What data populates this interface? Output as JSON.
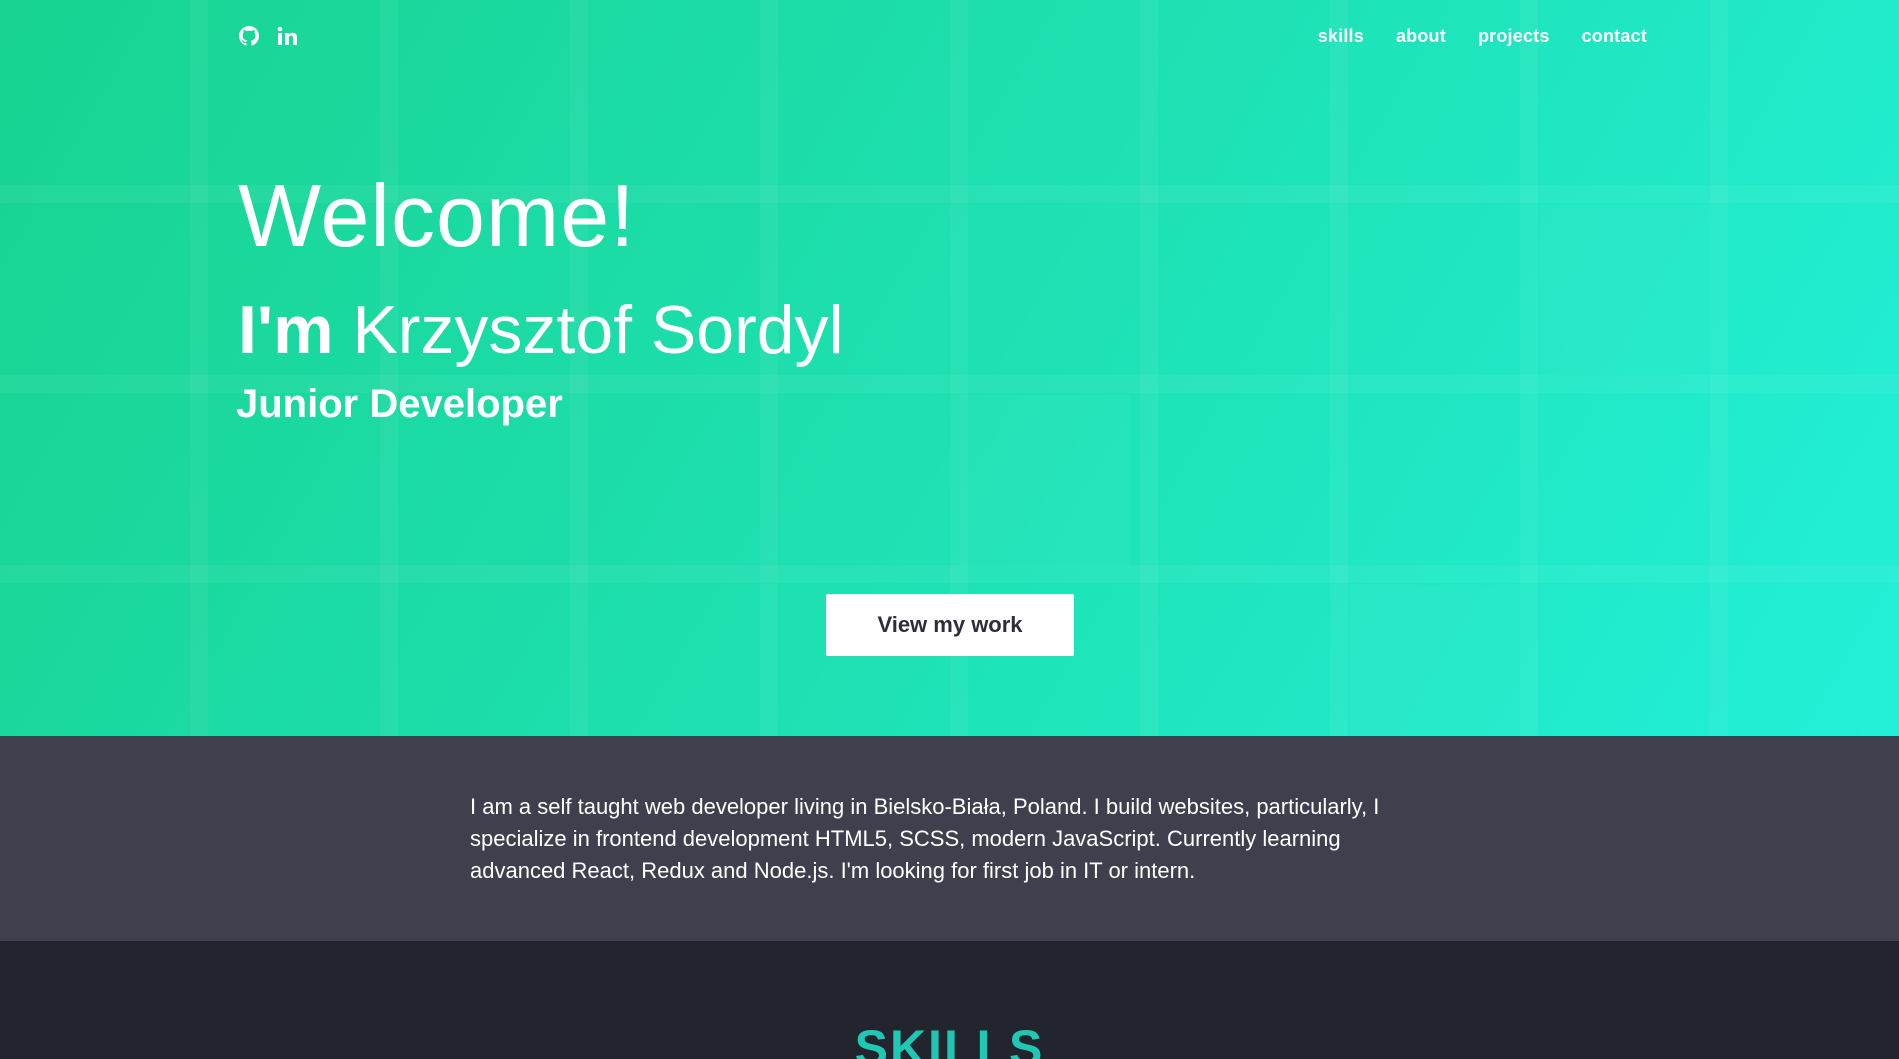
{
  "header": {
    "social": [
      {
        "icon": "github-icon",
        "label": "GitHub"
      },
      {
        "icon": "linkedin-icon",
        "label": "in"
      }
    ],
    "nav": [
      {
        "label": "skills"
      },
      {
        "label": "about"
      },
      {
        "label": "projects"
      },
      {
        "label": "contact"
      }
    ]
  },
  "hero": {
    "welcome": "Welcome!",
    "intro_prefix": "I'm ",
    "name": "Krzysztof Sordyl",
    "role": "Junior Developer",
    "cta_label": "View my work",
    "colors": {
      "from": "#18d391",
      "to": "#22f0d8"
    }
  },
  "about": {
    "text": "I am a self taught web developer living in Bielsko-Biała, Poland. I build websites, particularly, I specialize in frontend development HTML5, SCSS, modern JavaScript. Currently learning advanced React, Redux and Node.js. I'm looking for first job in IT or intern."
  },
  "skills": {
    "heading": "SKILLS",
    "accent": "#1fc8b3"
  }
}
